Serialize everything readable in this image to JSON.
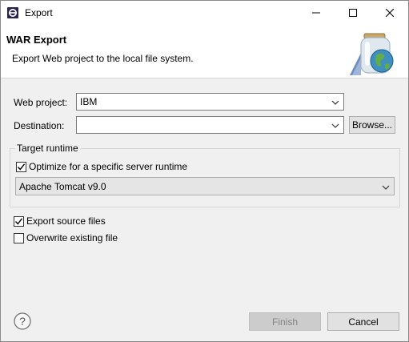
{
  "window": {
    "title": "Export",
    "icons": {
      "app": "eclipse-icon",
      "minimize": "minimize-icon",
      "maximize": "maximize-icon",
      "close": "close-icon"
    }
  },
  "banner": {
    "title": "WAR Export",
    "description": "Export Web project to the local file system.",
    "graphic": "jar-globe-graphic"
  },
  "form": {
    "web_project_label": "Web project:",
    "web_project_value": "IBM",
    "destination_label": "Destination:",
    "destination_value": "",
    "browse_label": "Browse...",
    "target_runtime": {
      "group_label": "Target runtime",
      "optimize_label": "Optimize for a specific server runtime",
      "optimize_checked": true,
      "runtime_value": "Apache Tomcat v9.0"
    },
    "export_source_label": "Export source files",
    "export_source_checked": true,
    "overwrite_label": "Overwrite existing file",
    "overwrite_checked": false
  },
  "footer": {
    "help_icon": "help-icon",
    "finish_label": "Finish",
    "finish_enabled": false,
    "cancel_label": "Cancel"
  },
  "colors": {
    "dialog_bg": "#f0f0f0",
    "banner_bg": "#ffffff",
    "disabled_button_bg": "#cccccc",
    "button_bg": "#e1e1e1",
    "checkmark": "#000000"
  }
}
